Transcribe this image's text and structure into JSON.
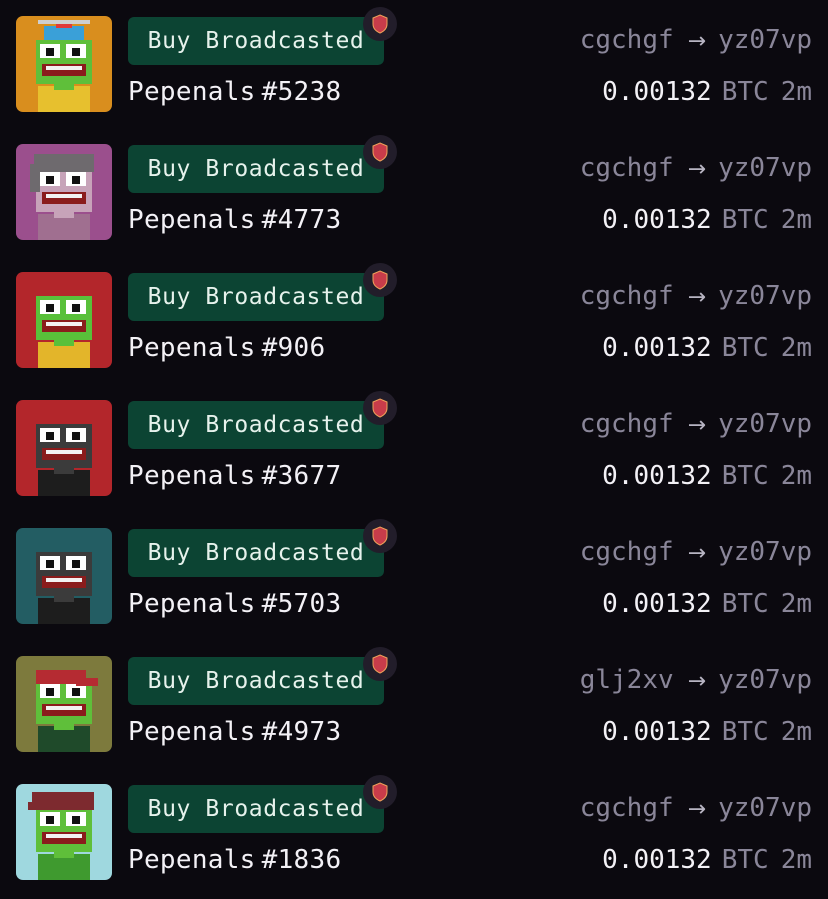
{
  "listings": [
    {
      "badge": "Buy Broadcasted",
      "collection": "Pepenals",
      "number": "#5238",
      "from": "cgchgf",
      "arrow": "→",
      "to": "yz07vp",
      "amount": "0.00132",
      "unit": "BTC",
      "age": "2m",
      "bg": "#d98e1e",
      "skin": "#5fbf3a",
      "outfit": "#e7c02e",
      "hat": "propeller-cap"
    },
    {
      "badge": "Buy Broadcasted",
      "collection": "Pepenals",
      "number": "#4773",
      "from": "cgchgf",
      "arrow": "→",
      "to": "yz07vp",
      "amount": "0.00132",
      "unit": "BTC",
      "age": "2m",
      "bg": "#9b4f8d",
      "skin": "#c7a3b9",
      "outfit": "#a06f90",
      "hat": "grey-hair"
    },
    {
      "badge": "Buy Broadcasted",
      "collection": "Pepenals",
      "number": "#906",
      "from": "cgchgf",
      "arrow": "→",
      "to": "yz07vp",
      "amount": "0.00132",
      "unit": "BTC",
      "age": "2m",
      "bg": "#b3262b",
      "skin": "#59c03a",
      "outfit": "#e3b52a",
      "hat": "none"
    },
    {
      "badge": "Buy Broadcasted",
      "collection": "Pepenals",
      "number": "#3677",
      "from": "cgchgf",
      "arrow": "→",
      "to": "yz07vp",
      "amount": "0.00132",
      "unit": "BTC",
      "age": "2m",
      "bg": "#b3262b",
      "skin": "#3b3b3b",
      "outfit": "#1d1d1d",
      "hat": "none"
    },
    {
      "badge": "Buy Broadcasted",
      "collection": "Pepenals",
      "number": "#5703",
      "from": "cgchgf",
      "arrow": "→",
      "to": "yz07vp",
      "amount": "0.00132",
      "unit": "BTC",
      "age": "2m",
      "bg": "#235d63",
      "skin": "#3b3b3b",
      "outfit": "#1d1d1d",
      "hat": "none"
    },
    {
      "badge": "Buy Broadcasted",
      "collection": "Pepenals",
      "number": "#4973",
      "from": "glj2xv",
      "arrow": "→",
      "to": "yz07vp",
      "amount": "0.00132",
      "unit": "BTC",
      "age": "2m",
      "bg": "#7d7a3d",
      "skin": "#5fbf3a",
      "outfit": "#1f4a2a",
      "hat": "red-cap"
    },
    {
      "badge": "Buy Broadcasted",
      "collection": "Pepenals",
      "number": "#1836",
      "from": "cgchgf",
      "arrow": "→",
      "to": "yz07vp",
      "amount": "0.00132",
      "unit": "BTC",
      "age": "2m",
      "bg": "#9fd8df",
      "skin": "#5fbf3a",
      "outfit": "#3f9a2f",
      "hat": "maroon-beret"
    }
  ],
  "colors": {
    "background": "#0b090f",
    "badge_bg": "#0c4433",
    "muted_text": "#8a8699",
    "shield": "#c83c4a"
  },
  "icons": {
    "verified": "shield-icon",
    "transfer": "arrow-right-icon"
  }
}
